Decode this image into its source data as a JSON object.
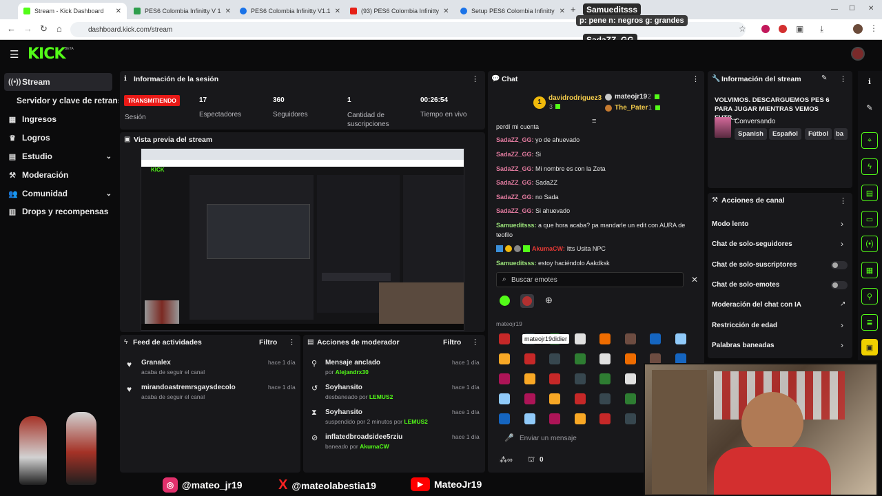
{
  "browser": {
    "tabs": [
      {
        "label": "Stream - Kick Dashboard",
        "color": "#53fc18"
      },
      {
        "label": "PES6 Colombia Infinitty V 1",
        "color": "#2e9e4c"
      },
      {
        "label": "PES6 Colombia Infinitty V1.1",
        "color": "#1a73e8"
      },
      {
        "label": "(93) PES6 Colombia Infinitty",
        "color": "#e62117"
      },
      {
        "label": "Setup PES6 Colombia Infinitty",
        "color": "#1a73e8"
      }
    ],
    "url": "dashboard.kick.com/stream"
  },
  "overlay": {
    "user1": "Samueditsss",
    "msg1": "p: pene n: negros g: grandes",
    "user2": "SadaZZ_GG"
  },
  "kick": {
    "logo": "KICK",
    "logo_badge": "BETA"
  },
  "sidebar": {
    "items": [
      {
        "label": "Stream",
        "icon": "broadcast-icon"
      },
      {
        "label": "Servidor y clave de retransm",
        "icon": ""
      },
      {
        "label": "Ingresos",
        "icon": "grid-icon"
      },
      {
        "label": "Logros",
        "icon": "trophy-icon"
      },
      {
        "label": "Estudio",
        "icon": "studio-icon"
      },
      {
        "label": "Moderación",
        "icon": "gavel-icon"
      },
      {
        "label": "Comunidad",
        "icon": "people-icon"
      },
      {
        "label": "Drops y recompensas",
        "icon": "gift-icon"
      }
    ]
  },
  "session": {
    "title": "Información de la sesión",
    "live_badge": "TRANSMITIENDO",
    "session_label": "Sesión",
    "stats": [
      {
        "value": "17",
        "label": "Espectadores"
      },
      {
        "value": "360",
        "label": "Seguidores"
      },
      {
        "value": "1",
        "label": "Cantidad de suscripciones"
      },
      {
        "value": "00:26:54",
        "label": "Tiempo en vivo"
      }
    ],
    "preview_title": "Vista previa del stream"
  },
  "feed": {
    "title": "Feed de actividades",
    "filter": "Filtro",
    "items": [
      {
        "name": "Granalex",
        "desc": "acaba de seguir el canal",
        "time": "hace 1 día"
      },
      {
        "name": "mirandoastremrsgaysdecolo",
        "desc": "acaba de seguir el canal",
        "time": "hace 1 día"
      }
    ]
  },
  "modactions": {
    "title": "Acciones de moderador",
    "filter": "Filtro",
    "items": [
      {
        "title": "Mensaje anclado",
        "pre": "por",
        "user": "Alejandrx30",
        "time": "hace 1 día",
        "icon": "pin-icon"
      },
      {
        "title": "Soyhansito",
        "pre": "desbaneado por",
        "user": "LEMUS2",
        "time": "hace 1 día",
        "icon": "undo-icon"
      },
      {
        "title": "Soyhansito",
        "pre": "suspendido por 2 minutos por",
        "user": "LEMUS2",
        "time": "hace 1 día",
        "icon": "hourglass-icon"
      },
      {
        "title": "inflatedbroadsidee5rziu",
        "pre": "baneado por",
        "user": "AkumaCW",
        "time": "hace 1 día",
        "icon": "ban-icon"
      }
    ]
  },
  "chat": {
    "title": "Chat",
    "gifters": [
      {
        "name": "davidrodriguez3",
        "count": "3"
      },
      {
        "name": "mateojr19",
        "count": "2"
      },
      {
        "name": "The_Pater",
        "count": "1"
      }
    ],
    "messages": [
      {
        "user": "",
        "text": "perdí mi cuenta"
      },
      {
        "user": "SadaZZ_GG:",
        "text": "yo de ahuevado"
      },
      {
        "user": "SadaZZ_GG:",
        "text": "Si"
      },
      {
        "user": "SadaZZ_GG:",
        "text": "Mi nombre es con la Zeta"
      },
      {
        "user": "SadaZZ_GG:",
        "text": "SadaZZ"
      },
      {
        "user": "SadaZZ_GG:",
        "text": "no Sada"
      },
      {
        "user": "SadaZZ_GG:",
        "text": "Si ahuevado"
      },
      {
        "user": "Samueditsss:",
        "text": "a que hora acaba? pa mandarle un edit con AURA de"
      },
      {
        "user": "",
        "text": "teofilo"
      },
      {
        "user": "AkumaCW:",
        "text": "ltts Usita NPC"
      },
      {
        "user": "Samueditsss:",
        "text": "estoy haciéndolo Aakdksk"
      }
    ],
    "emote_search_placeholder": "Buscar emotes",
    "emote_section": "mateojr19",
    "emote_tooltip": "mateojr19didier",
    "input_placeholder": "Enviar un mensaje",
    "points": "0"
  },
  "streaminfo": {
    "title": "Información del stream",
    "stream_title": "VOLVIMOS. DESCARGUEMOS PES 6 PARA JUGAR MIENTRAS VEMOS FUTB...",
    "category": "Conversando",
    "tags": [
      "Spanish",
      "Español",
      "Fútbol",
      "ba"
    ]
  },
  "channel_actions": {
    "title": "Acciones de canal",
    "items": [
      {
        "label": "Modo lento",
        "control": "chevron"
      },
      {
        "label": "Chat de solo-seguidores",
        "control": "chevron"
      },
      {
        "label": "Chat de solo-suscriptores",
        "control": "toggle"
      },
      {
        "label": "Chat de solo-emotes",
        "control": "toggle"
      },
      {
        "label": "Moderación del chat con IA",
        "control": "external"
      },
      {
        "label": "Restricción de edad",
        "control": "chevron"
      },
      {
        "label": "Palabras baneadas",
        "control": "chevron"
      }
    ]
  },
  "socials": [
    {
      "handle": "@mateo_jr19",
      "icon": "instagram-icon",
      "color": "#e1306c"
    },
    {
      "handle": "@mateolabestia19",
      "icon": "x-icon",
      "color": "#ff2222"
    },
    {
      "handle": "MateoJr19",
      "icon": "youtube-icon",
      "color": "#ff0000"
    }
  ],
  "colors": {
    "accent": "#53fc18",
    "live": "#e91916",
    "panel": "#18181b"
  }
}
